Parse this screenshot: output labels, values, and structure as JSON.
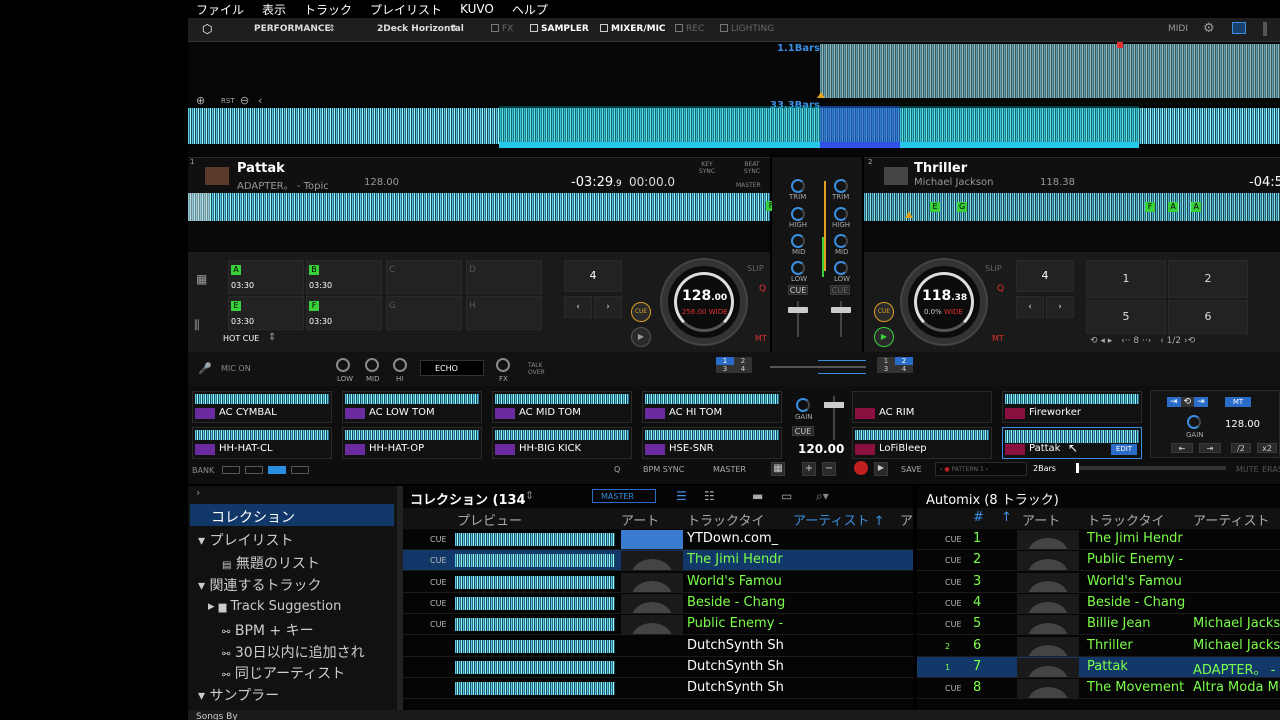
{
  "menu": [
    "ファイル",
    "表示",
    "トラック",
    "プレイリスト",
    "KUVO",
    "ヘルプ"
  ],
  "toolbar": {
    "mode": "PERFORMANCE",
    "layout": "2Deck Horizontal",
    "fx": "FX",
    "sampler": "SAMPLER",
    "mixer": "MIXER/MIC",
    "rec": "REC",
    "lighting": "LIGHTING",
    "midi": "MIDI"
  },
  "overview": {
    "top_bars": "1.1Bars",
    "mid_bars": "33.3Bars",
    "rst": "RST"
  },
  "deck1": {
    "num": "1",
    "title": "Pattak",
    "artist": "ADAPTER。 - Topic",
    "bpm_small": "128.00",
    "remain": "-03:29",
    "remain_frac": ".9",
    "elapsed": "00:00.0",
    "key_sync": "KEY SYNC",
    "beat_sync": "BEAT SYNC",
    "master": "MASTER",
    "jog_bpm": "128",
    "jog_bpm_dec": ".00",
    "jog_pitch": "256.00",
    "jog_range": "WIDE",
    "slip": "SLIP",
    "cue": "CUE",
    "mt": "MT",
    "loop": "4",
    "hotcue_label": "HOT CUE",
    "hotcues": [
      {
        "k": "A",
        "t": "03:30"
      },
      {
        "k": "B",
        "t": "03:30"
      },
      {
        "k": "C",
        "t": ""
      },
      {
        "k": "D",
        "t": ""
      },
      {
        "k": "E",
        "t": "03:30"
      },
      {
        "k": "F",
        "t": "03:30"
      },
      {
        "k": "G",
        "t": ""
      },
      {
        "k": "H",
        "t": ""
      }
    ]
  },
  "deck2": {
    "num": "2",
    "title": "Thriller",
    "artist": "Michael Jackson",
    "bpm_small": "118.38",
    "remain": "-04:5",
    "jog_bpm": "118",
    "jog_bpm_dec": ".38",
    "jog_pitch": "0.0%",
    "jog_range": "WIDE",
    "slip": "SLIP",
    "cue": "CUE",
    "mt": "MT",
    "loop": "4",
    "pads": [
      "1",
      "2",
      "5",
      "6"
    ],
    "beatjump": "8",
    "loop_frac": "1/2"
  },
  "mixer": {
    "trim": "TRIM",
    "high": "HIGH",
    "mid": "MID",
    "low": "LOW",
    "cue": "CUE"
  },
  "mic": {
    "label": "MIC ON",
    "low": "LOW",
    "mid": "MID",
    "hi": "HI",
    "fx": "FX",
    "echo": "ECHO",
    "talkover": "TALK OVER"
  },
  "sampler": {
    "slots": [
      "AC CYMBAL",
      "AC LOW TOM",
      "AC MID TOM",
      "AC HI TOM",
      "HH-HAT-CL",
      "HH-HAT-OP",
      "HH-BIG KICK",
      "HSE-SNR"
    ],
    "gain": "GAIN",
    "cue": "CUE",
    "bpm": "120.00",
    "bank": "BANK",
    "q": "Q",
    "bpm_sync": "BPM SYNC",
    "master": "MASTER"
  },
  "seq": {
    "slots": [
      "AC RIM",
      "Fireworker",
      "LoFiBleep",
      "Pattak"
    ],
    "edit": "EDIT",
    "save": "SAVE",
    "pattern": "PATTERN 1",
    "bars": "2Bars",
    "mute": "MUTE",
    "erase": "ERAS",
    "gain": "GAIN",
    "bpm": "128.00",
    "div1": "/2",
    "div2": "x2",
    "mt": "MT"
  },
  "sidebar": {
    "collection": "コレクション",
    "playlist": "プレイリスト",
    "untitled": "無題のリスト",
    "related": "関連するトラック",
    "suggestion": "Track Suggestion",
    "bpmkey": "BPM + キー",
    "recent": "30日以内に追加され",
    "sameartist": "同じアーティスト",
    "sampler": "サンプラー"
  },
  "collection": {
    "title": "コレクション (134",
    "master": "MASTER",
    "h_preview": "プレビュー",
    "h_art": "アート",
    "h_title": "トラックタイ",
    "h_artist": "アーティスト ↑",
    "h_more": "ア",
    "rows": [
      {
        "cue": "CUE",
        "title": "YTDown.com_",
        "tc": "#ffffff"
      },
      {
        "cue": "CUE",
        "title": "The Jimi Hendr",
        "tc": "#7cff4a"
      },
      {
        "cue": "CUE",
        "title": "World's Famou",
        "tc": "#7cff4a"
      },
      {
        "cue": "CUE",
        "title": "Beside - Chang",
        "tc": "#7cff4a"
      },
      {
        "cue": "CUE",
        "title": "Public Enemy -",
        "tc": "#7cff4a"
      },
      {
        "cue": "",
        "title": "DutchSynth Sh",
        "tc": "#ffffff"
      },
      {
        "cue": "",
        "title": "DutchSynth Sh",
        "tc": "#ffffff"
      },
      {
        "cue": "",
        "title": "DutchSynth Sh",
        "tc": "#ffffff"
      }
    ]
  },
  "automix": {
    "title": "Automix (8 トラック)",
    "h_num": "#",
    "h_art": "アート",
    "h_title": "トラックタイ",
    "h_artist": "アーティスト",
    "rows": [
      {
        "cue": "CUE",
        "n": "1",
        "title": "The Jimi Hendr",
        "artist": "",
        "tc": "#7cff4a"
      },
      {
        "cue": "CUE",
        "n": "2",
        "title": "Public Enemy -",
        "artist": "",
        "tc": "#7cff4a"
      },
      {
        "cue": "CUE",
        "n": "3",
        "title": "World's Famou",
        "artist": "",
        "tc": "#7cff4a"
      },
      {
        "cue": "CUE",
        "n": "4",
        "title": "Beside - Chang",
        "artist": "",
        "tc": "#7cff4a"
      },
      {
        "cue": "CUE",
        "n": "5",
        "title": "Billie Jean",
        "artist": "Michael Jacks",
        "tc": "#7cff4a"
      },
      {
        "cue": "2",
        "n": "6",
        "title": "Thriller",
        "artist": "Michael Jacks",
        "tc": "#7cff4a"
      },
      {
        "cue": "1",
        "n": "7",
        "title": "Pattak",
        "artist": "ADAPTER。 -",
        "tc": "#7cff4a"
      },
      {
        "cue": "CUE",
        "n": "8",
        "title": "The Movement",
        "artist": "Altra Moda Mu",
        "tc": "#7cff4a"
      }
    ]
  },
  "bottom": {
    "label": "Songs By"
  },
  "colors": {
    "accent": "#3a8fe0",
    "green": "#7cff4a",
    "purple": "#6a2aa0",
    "red": "#e03030"
  }
}
